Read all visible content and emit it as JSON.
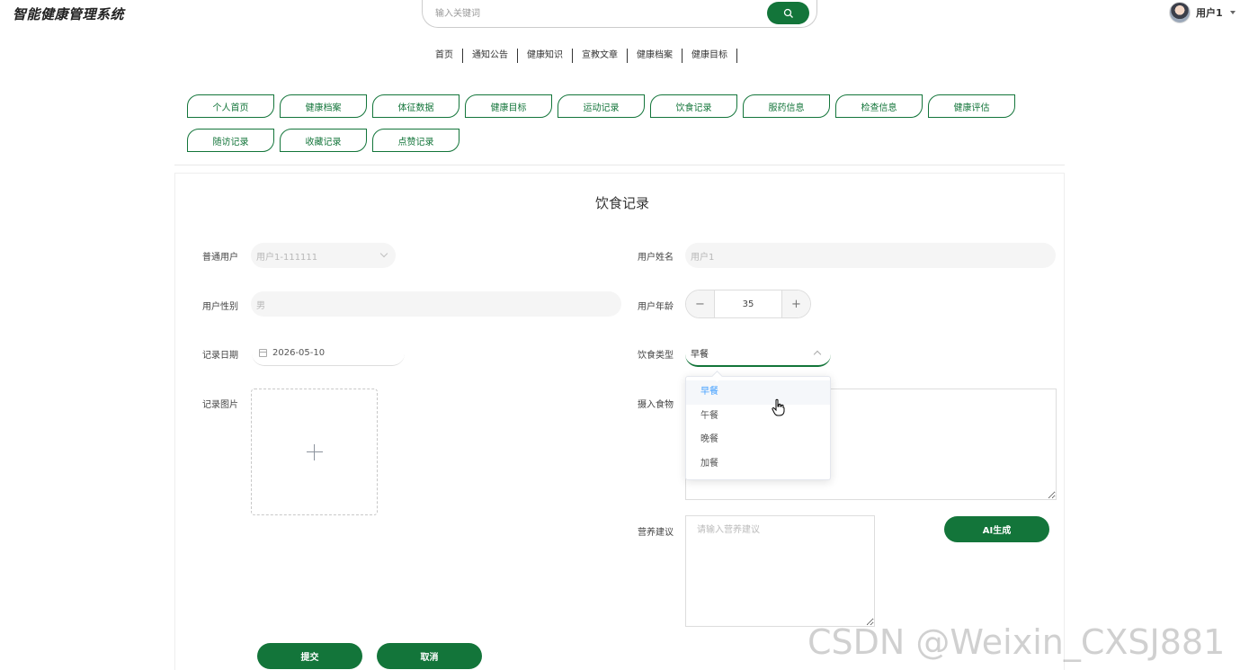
{
  "app": {
    "title": "智能健康管理系统"
  },
  "search": {
    "placeholder": "输入关键词"
  },
  "user": {
    "name": "用户1"
  },
  "main_nav": [
    "首页",
    "通知公告",
    "健康知识",
    "宣教文章",
    "健康档案",
    "健康目标"
  ],
  "sub_tabs": [
    "个人首页",
    "健康档案",
    "体征数据",
    "健康目标",
    "运动记录",
    "饮食记录",
    "服药信息",
    "检查信息",
    "健康评估",
    "随访记录",
    "收藏记录",
    "点赞记录"
  ],
  "form": {
    "title": "饮食记录",
    "user_account_label": "普通用户",
    "user_account_value": "用户1-111111",
    "user_name_label": "用户姓名",
    "user_name_value": "用户1",
    "gender_label": "用户性别",
    "gender_value": "男",
    "age_label": "用户年龄",
    "age_value": "35",
    "date_label": "记录日期",
    "date_value": "2026-05-10",
    "meal_type_label": "饮食类型",
    "meal_type_value": "早餐",
    "meal_type_options": [
      "早餐",
      "午餐",
      "晚餐",
      "加餐"
    ],
    "image_label": "记录图片",
    "food_label": "摄入食物",
    "advice_label": "营养建议",
    "advice_placeholder": "请输入营养建议",
    "ai_button": "AI生成",
    "submit_button": "提交",
    "cancel_button": "取消"
  },
  "watermark": "CSDN @Weixin_CXSJ881",
  "colors": {
    "accent": "#13753a",
    "selected_option": "#409eff"
  }
}
